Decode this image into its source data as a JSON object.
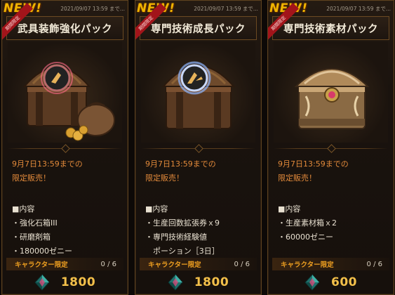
{
  "cards": [
    {
      "badge": "NEW!",
      "timestamp": "2021/09/07 13:59 まで...",
      "ribbon": "期間限定",
      "title": "武具装飾強化パック",
      "art_icon": "treasure-chest-with-coin-bag",
      "sale_line1": "9月7日13:59までの",
      "sale_line2": "限定販売！",
      "contents_header": "■内容",
      "items": [
        "・強化石箱III",
        "・研磨剤箱",
        "・180000ゼニー"
      ],
      "limit_label": "キャラクター限定",
      "limit_count": "0 / 6",
      "currency_icon": "teal-gem-icon",
      "price": "1800"
    },
    {
      "badge": "NEW!",
      "timestamp": "2021/09/07 13:59 まで...",
      "ribbon": "期間限定",
      "title": "専門技術成長パック",
      "art_icon": "treasure-chest-blue-glow",
      "sale_line1": "9月7日13:59までの",
      "sale_line2": "限定販売！",
      "contents_header": "■内容",
      "items": [
        "・生産回数拡張券ｘ9",
        "・専門技術経験値",
        "　ポーション［3日］"
      ],
      "limit_label": "キャラクター限定",
      "limit_count": "0 / 6",
      "currency_icon": "teal-gem-icon",
      "price": "1800"
    },
    {
      "badge": "NEW!",
      "timestamp": "2021/09/07 13:59 まで...",
      "ribbon": "期間限定",
      "title": "専門技術素材パック",
      "art_icon": "ornate-gold-chest",
      "sale_line1": "9月7日13:59までの",
      "sale_line2": "限定販売！",
      "contents_header": "■内容",
      "items": [
        "・生産素材箱ｘ2",
        "・60000ゼニー"
      ],
      "limit_label": "キャラクター限定",
      "limit_count": "0 / 6",
      "currency_icon": "teal-gem-icon",
      "price": "600"
    }
  ],
  "colors": {
    "new_badge": "#f0b400",
    "sale_text": "#e28a3a",
    "limit_label": "#f0a020",
    "price": "#f3c04a",
    "border": "#5e4220"
  }
}
